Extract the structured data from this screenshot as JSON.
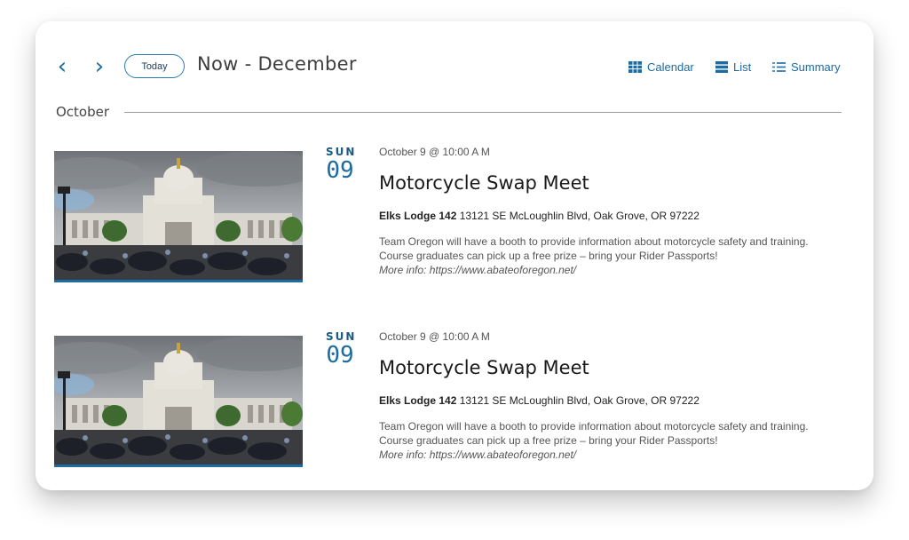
{
  "toolbar": {
    "prev_icon": "chevron-left-icon",
    "next_icon": "chevron-right-icon",
    "today_label": "Today",
    "range_title": "Now - December",
    "views": [
      {
        "label": "Calendar",
        "icon": "calendar-grid-icon"
      },
      {
        "label": "List",
        "icon": "list-icon"
      },
      {
        "label": "Summary",
        "icon": "summary-icon"
      }
    ]
  },
  "month_label": "October",
  "events": [
    {
      "dow": "SUN",
      "day": "09",
      "datetime": "October 9 @ 10:00 A M",
      "title": "Motorcycle Swap Meet",
      "venue_name": "Elks Lodge 142",
      "venue_address": "13121 SE McLoughlin Blvd, Oak Grove, OR 97222",
      "description": "Team Oregon will have a booth to provide information about motorcycle safety and training. Course graduates can pick up a free prize – bring your Rider Passports!",
      "more_info": "More info: https://www.abateoforegon.net/"
    },
    {
      "dow": "SUN",
      "day": "09",
      "datetime": "October 9 @ 10:00 A M",
      "title": "Motorcycle Swap Meet",
      "venue_name": "Elks Lodge 142",
      "venue_address": "13121 SE McLoughlin Blvd, Oak Grove, OR 97222",
      "description": "Team Oregon will have a booth to provide information about motorcycle safety and training. Course graduates can pick up a free prize – bring your Rider Passports!",
      "more_info": "More info: https://www.abateoforegon.net/"
    }
  ],
  "colors": {
    "accent": "#1c6ba1",
    "text": "#1a1a1a",
    "muted": "#555555"
  }
}
